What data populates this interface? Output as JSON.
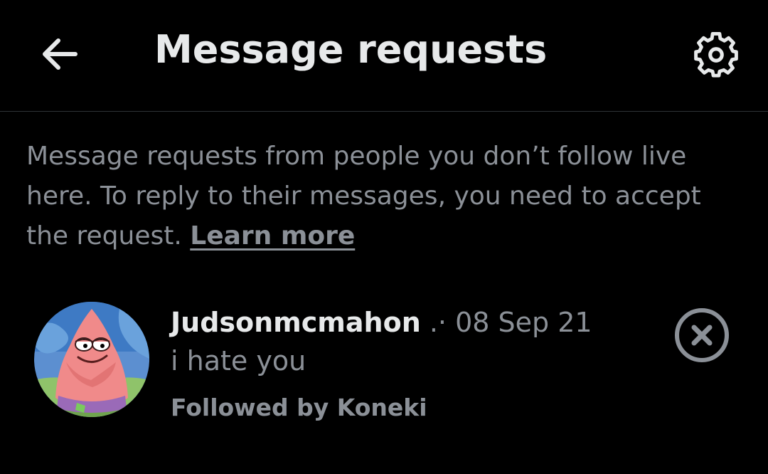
{
  "header": {
    "title": "Message requests",
    "back_icon": "arrow-left-icon",
    "settings_icon": "gear-icon"
  },
  "info": {
    "text": "Message requests from people you don’t follow live here. To reply to their messages, you need to accept the request. ",
    "link_label": "Learn more"
  },
  "requests": [
    {
      "name": "Judsonmcmahon",
      "separator": ".·",
      "date": "08 Sep 21",
      "message": "i hate you",
      "followed_by": "Followed by Koneki",
      "dismiss_icon": "close-circle-icon"
    }
  ],
  "colors": {
    "background": "#000000",
    "primary_text": "#e7e9ea",
    "secondary_text": "#8b9097",
    "divider": "#2f3336"
  }
}
